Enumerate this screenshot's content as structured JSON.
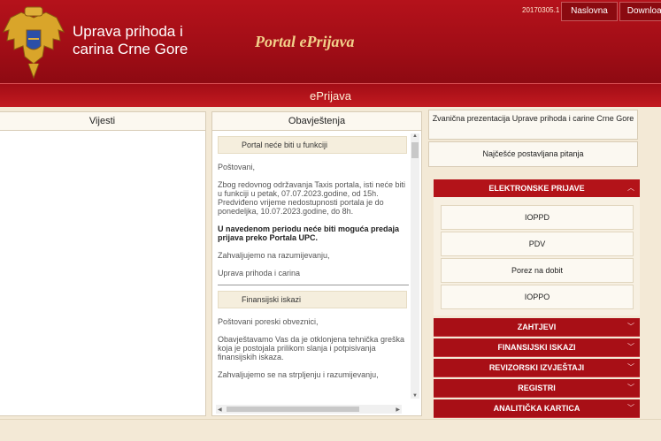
{
  "header": {
    "org_name": "Uprava prihoda i carina Crne Gore",
    "portal_title": "Portal ePrijava",
    "version": "20170305.1",
    "nav": {
      "home": "Naslovna",
      "download": "Download"
    }
  },
  "subbar": {
    "title": "ePrijava"
  },
  "vijesti": {
    "title": "Vijesti"
  },
  "obavjestenja": {
    "title": "Obavještenja",
    "notice1": {
      "title": "Portal neće biti u funkciji",
      "greeting": "Poštovani,",
      "body": "Zbog redovnog održavanja Taxis portala, isti neće biti u funkciji u petak, 07.07.2023.godine, od 15h. Predviđeno vrijeme nedostupnosti portala je do ponedeljka, 10.07.2023.godine, do 8h.",
      "bold": "U navedenom periodu neće biti moguća predaja prijava preko Portala UPC.",
      "thanks": "Zahvaljujemo na razumijevanju,",
      "signature": "Uprava prihoda i carina"
    },
    "notice2": {
      "title": "Finansijski iskazi",
      "greeting": "Poštovani poreski obveznici,",
      "body": "Obavještavamo Vas da je otklonjena tehnička greška koja je postojala prilikom slanja i potpisivanja finansijskih iskaza.",
      "thanks": "Zahvaljujemo se na strpljenju i razumijevanju,"
    }
  },
  "links": {
    "official": "Zvanična prezentacija Uprave prihoda i carine Crne Gore",
    "faq": "Najčešće postavljana pitanja"
  },
  "elektronske": {
    "title": "ELEKTRONSKE PRIJAVE",
    "items": [
      "IOPPD",
      "PDV",
      "Porez na dobit",
      "IOPPO"
    ]
  },
  "menu": [
    "ZAHTJEVI",
    "FINANSIJSKI ISKAZI",
    "REVIZORSKI IZVJEŠTAJI",
    "REGISTRI",
    "ANALITIČKA KARTICA"
  ]
}
